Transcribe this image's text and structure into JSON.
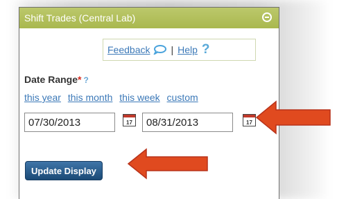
{
  "panel": {
    "title": "Shift Trades (Central Lab)",
    "feedback_label": "Feedback",
    "separator": "|",
    "help_label": "Help",
    "help_mark": "?"
  },
  "date_range": {
    "label": "Date Range",
    "required_mark": "*",
    "help_mark": "?",
    "presets": [
      "this year",
      "this month",
      "this week",
      "custom"
    ],
    "start_date": "07/30/2013",
    "end_date": "08/31/2013",
    "calendar_day": "17"
  },
  "actions": {
    "update_label": "Update Display"
  },
  "colors": {
    "header": "#acbb55",
    "link": "#3c79b8",
    "button": "#2a5b8c",
    "arrow": "#e04a1f"
  },
  "icons": [
    "collapse-icon",
    "feedback-bubble-icon",
    "calendar-icon",
    "arrow-icon"
  ]
}
